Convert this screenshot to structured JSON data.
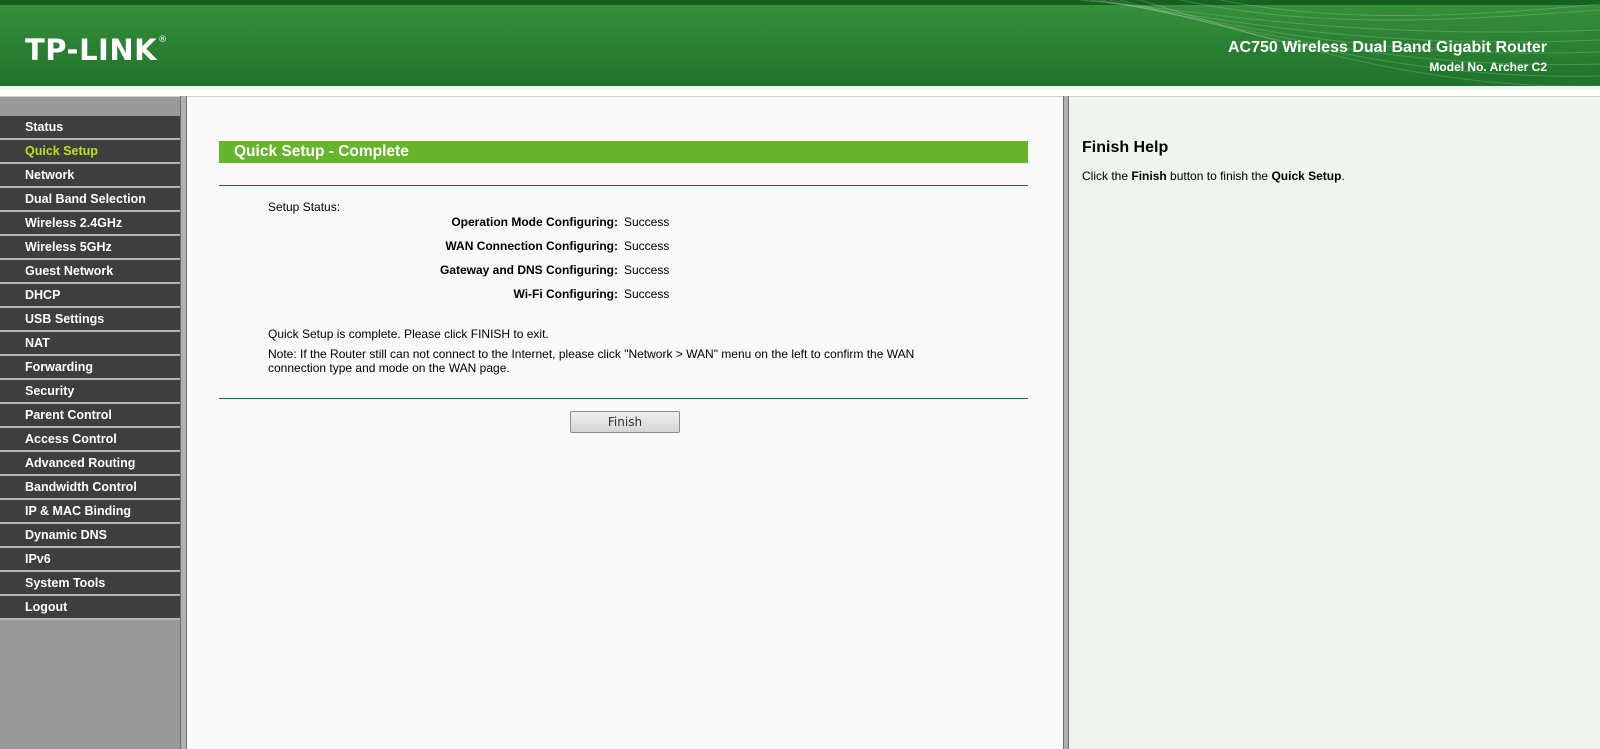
{
  "header": {
    "logo_text": "TP-LINK",
    "logo_reg": "®",
    "product_name": "AC750 Wireless Dual Band Gigabit Router",
    "model": "Model No. Archer C2"
  },
  "sidebar": {
    "active_item": "Quick Setup",
    "items": [
      {
        "label": "Status"
      },
      {
        "label": "Quick Setup"
      },
      {
        "label": "Network"
      },
      {
        "label": "Dual Band Selection"
      },
      {
        "label": "Wireless 2.4GHz"
      },
      {
        "label": "Wireless 5GHz"
      },
      {
        "label": "Guest Network"
      },
      {
        "label": "DHCP"
      },
      {
        "label": "USB Settings"
      },
      {
        "label": "NAT"
      },
      {
        "label": "Forwarding"
      },
      {
        "label": "Security"
      },
      {
        "label": "Parent Control"
      },
      {
        "label": "Access Control"
      },
      {
        "label": "Advanced Routing"
      },
      {
        "label": "Bandwidth Control"
      },
      {
        "label": "IP & MAC Binding"
      },
      {
        "label": "Dynamic DNS"
      },
      {
        "label": "IPv6"
      },
      {
        "label": "System Tools"
      },
      {
        "label": "Logout"
      }
    ]
  },
  "main": {
    "title": "Quick Setup - Complete",
    "setup_status_label": "Setup Status:",
    "status_rows": [
      {
        "label": "Operation Mode Configuring:",
        "value": "Success"
      },
      {
        "label": "WAN Connection Configuring:",
        "value": "Success"
      },
      {
        "label": "Gateway and DNS Configuring:",
        "value": "Success"
      },
      {
        "label": "Wi-Fi Configuring:",
        "value": "Success"
      }
    ],
    "complete_message": "Quick Setup is complete. Please click FINISH to exit.",
    "note_message": "Note: If the Router still can not connect to the Internet, please click \"Network > WAN\" menu on the left to confirm the WAN connection type and mode on the WAN page.",
    "finish_button": "Finish"
  },
  "help": {
    "title": "Finish Help",
    "text_prefix": "Click the ",
    "text_bold_1": "Finish",
    "text_middle": " button to finish the ",
    "text_bold_2": "Quick Setup",
    "text_suffix": "."
  },
  "colors": {
    "header_green": "#2b8233",
    "title_bar_green": "#67b42d",
    "menu_bg": "#3e3e3e",
    "menu_active_text": "#b9e21c",
    "help_bg": "#eff5ee"
  }
}
